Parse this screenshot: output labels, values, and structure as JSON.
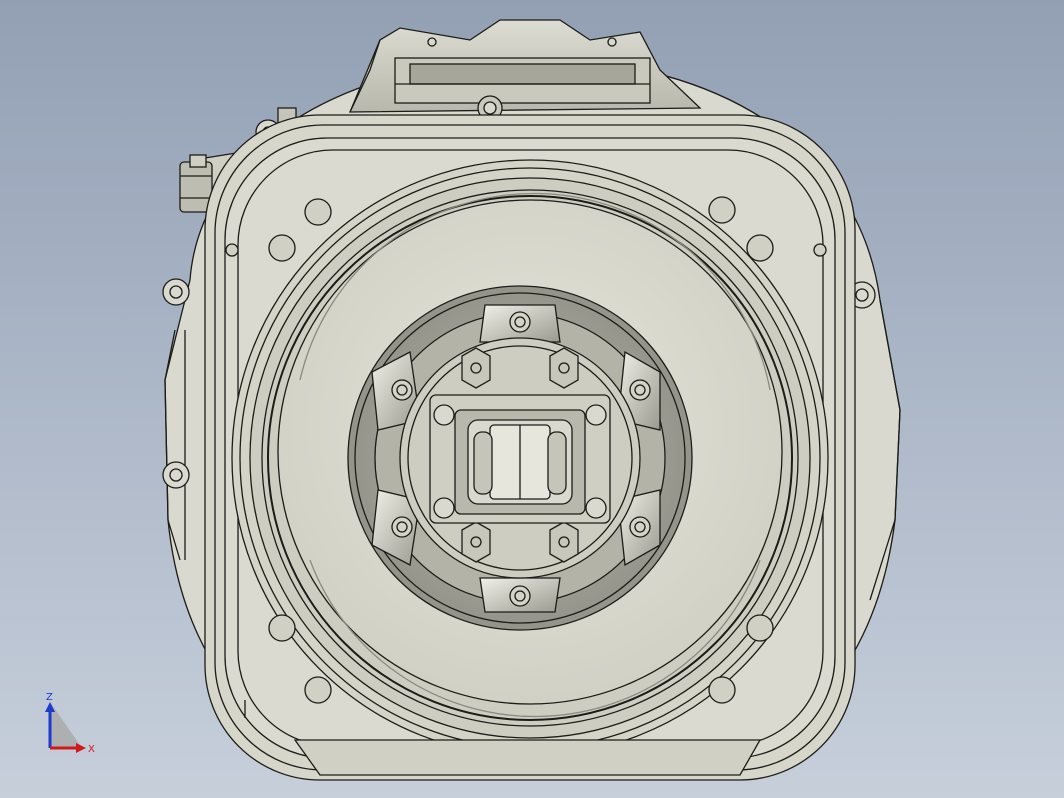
{
  "viewport": {
    "background_top": "#93a0b4",
    "background_bottom": "#c7cfdb",
    "model_fill": "#d9d9cf",
    "model_edge": "#1c1c18"
  },
  "triad": {
    "z_label": "Z",
    "x_label": "X",
    "z_color": "#1a3ad0",
    "x_color": "#d01a1a"
  }
}
